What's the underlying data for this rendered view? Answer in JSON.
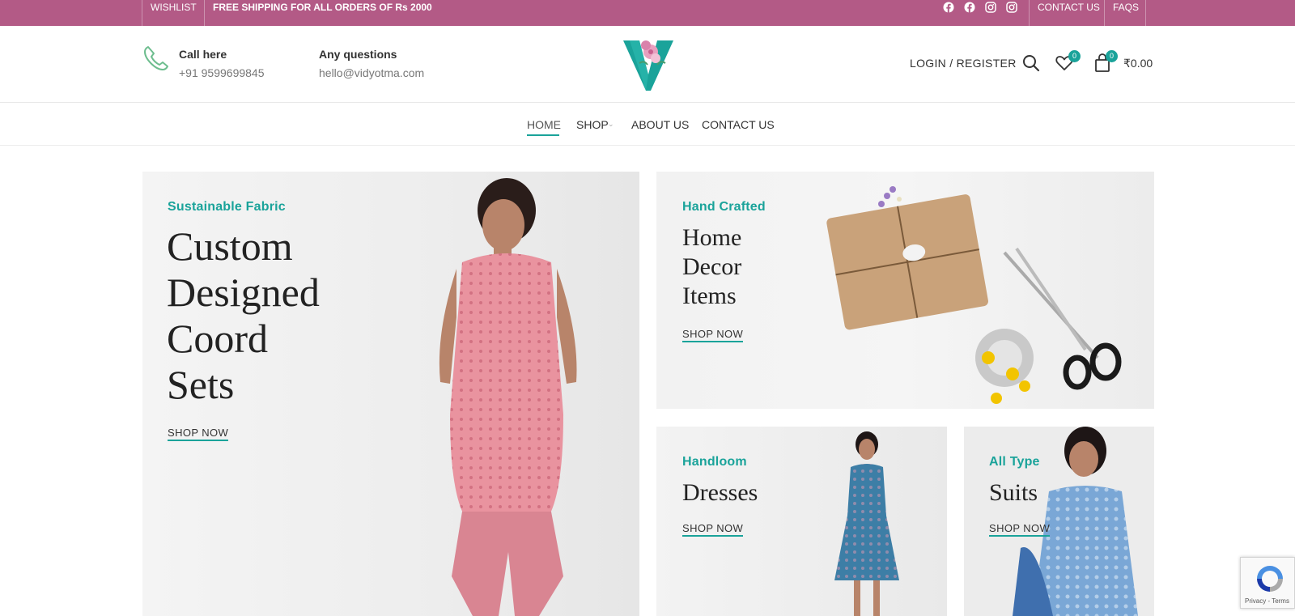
{
  "topbar": {
    "wishlist": "WISHLIST",
    "shipping": "FREE SHIPPING FOR ALL ORDERS OF Rs 2000",
    "social_icons": [
      "facebook-icon",
      "facebook-icon",
      "instagram-icon",
      "instagram-icon"
    ],
    "contact": "CONTACT US",
    "faqs": "FAQS",
    "bg_color": "#b35a86"
  },
  "header": {
    "call_title": "Call here",
    "call_value": "+91 9599699845",
    "questions_title": "Any questions",
    "questions_value": "hello@vidyotma.com",
    "logo_letter": "V",
    "login": "LOGIN / REGISTER",
    "wishlist_count": "0",
    "cart_count": "0",
    "cart_total": "₹0.00",
    "accent_color": "#1aa39a"
  },
  "nav": {
    "items": [
      {
        "label": "HOME",
        "active": true
      },
      {
        "label": "SHOP"
      },
      {
        "label": "ABOUT US"
      },
      {
        "label": "CONTACT US"
      }
    ]
  },
  "banners": {
    "main": {
      "eyebrow": "Sustainable Fabric",
      "title_lines": [
        "Custom",
        "Designed",
        "Coord",
        "Sets"
      ],
      "cta": "SHOP NOW"
    },
    "home_decor": {
      "eyebrow": "Hand Crafted",
      "title_lines": [
        "Home",
        "Decor",
        "Items"
      ],
      "cta": "SHOP NOW"
    },
    "dresses": {
      "eyebrow": "Handloom",
      "title": "Dresses",
      "cta": "SHOP NOW"
    },
    "suits": {
      "eyebrow": "All Type",
      "title": "Suits",
      "cta": "SHOP NOW"
    }
  },
  "recaptcha": {
    "text": "Privacy - Terms"
  }
}
